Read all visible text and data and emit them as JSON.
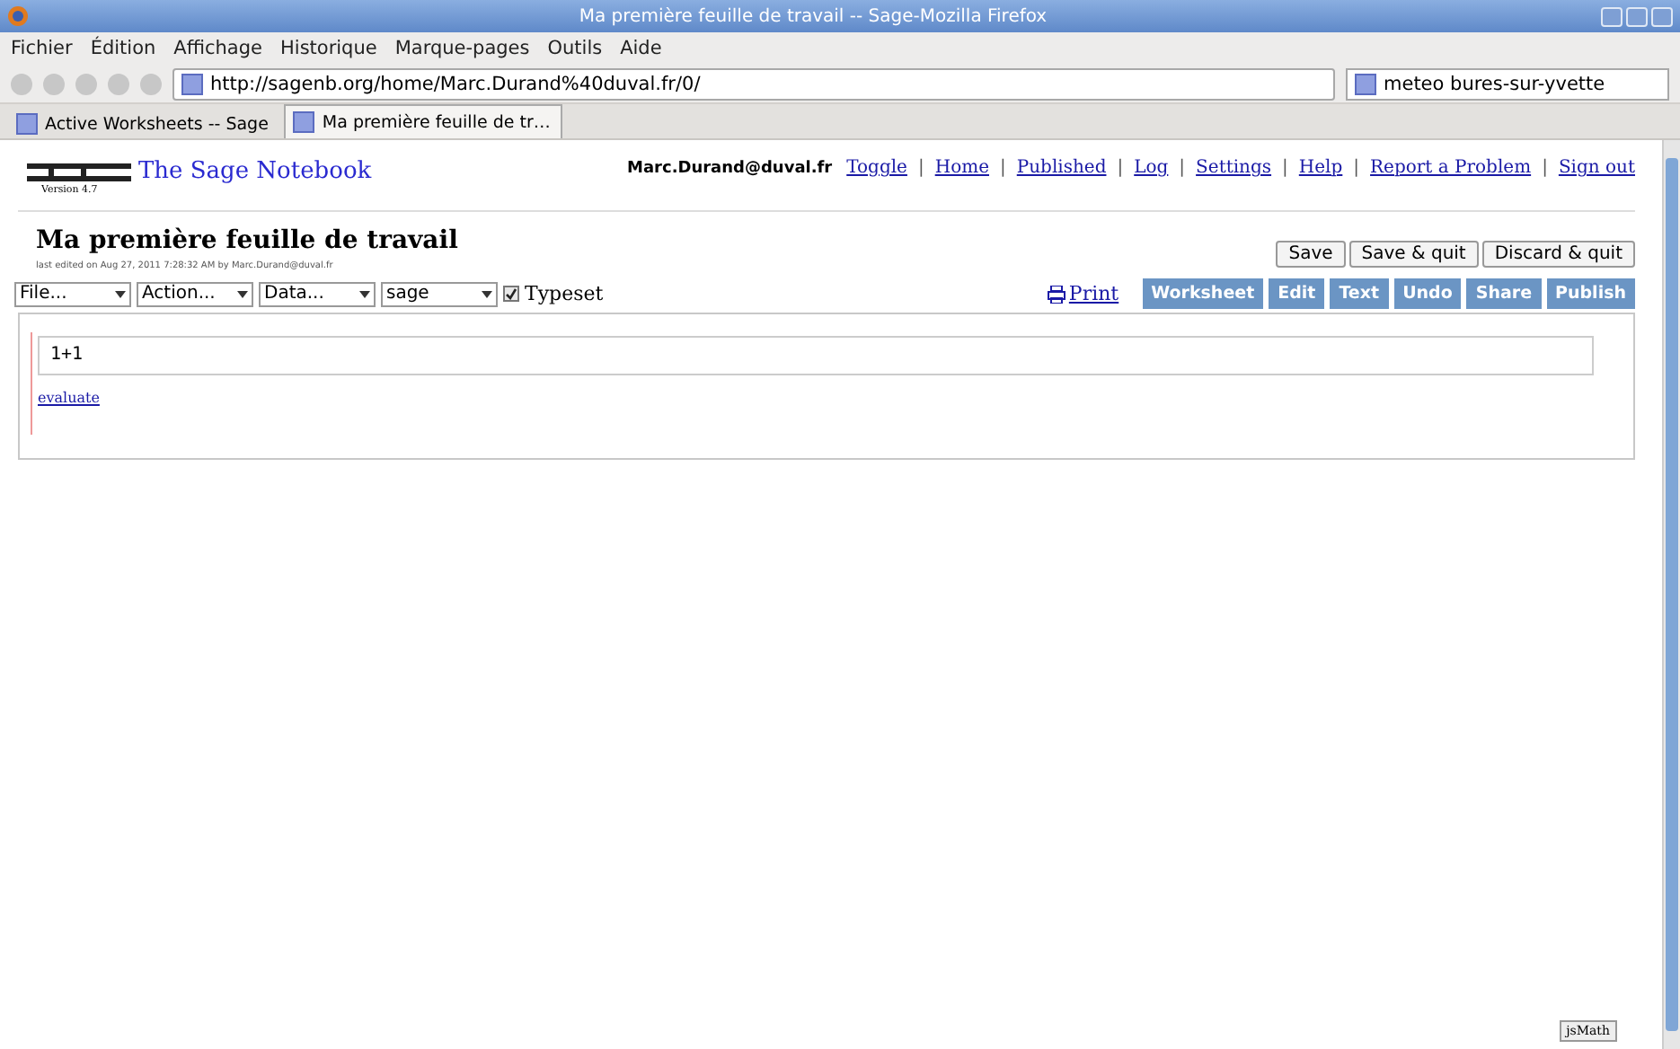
{
  "window": {
    "title": "Ma première feuille de travail -- Sage-Mozilla Firefox"
  },
  "menu": [
    "Fichier",
    "Édition",
    "Affichage",
    "Historique",
    "Marque-pages",
    "Outils",
    "Aide"
  ],
  "address": {
    "url": "http://sagenb.org/home/Marc.Durand%40duval.fr/0/"
  },
  "search": {
    "value": "meteo bures-sur-yvette"
  },
  "tabs": [
    {
      "label": "Active Worksheets -- Sage",
      "selected": false
    },
    {
      "label": "Ma première feuille de tr…",
      "selected": true
    }
  ],
  "header": {
    "title": "The Sage Notebook",
    "version": "Version 4.7",
    "user": "Marc.Durand@duval.fr",
    "links": [
      {
        "label": "Toggle",
        "separator": "|"
      },
      {
        "label": "Home",
        "separator": "|"
      },
      {
        "label": "Published",
        "separator": "|"
      },
      {
        "label": "Log",
        "separator": "|"
      },
      {
        "label": "Settings",
        "separator": "|"
      },
      {
        "label": "Help",
        "separator": "|"
      },
      {
        "label": "Report a Problem",
        "separator": "|"
      },
      {
        "label": "Sign out"
      }
    ]
  },
  "worksheet": {
    "title": "Ma première feuille de travail",
    "edited": "last edited on Aug 27, 2011 7:28:32 AM by Marc.Durand@duval.fr",
    "buttons": [
      "Save",
      "Save & quit",
      "Discard & quit"
    ],
    "selects": [
      "File...",
      "Action...",
      "Data...",
      "sage"
    ],
    "typeset": {
      "label": "Typeset",
      "checked": true
    },
    "print": "Print",
    "views": [
      "Worksheet",
      "Edit",
      "Text",
      "Undo",
      "Share",
      "Publish"
    ]
  },
  "cell": {
    "input": "1+1",
    "evaluate": "evaluate"
  },
  "jsmath": "jsMath"
}
